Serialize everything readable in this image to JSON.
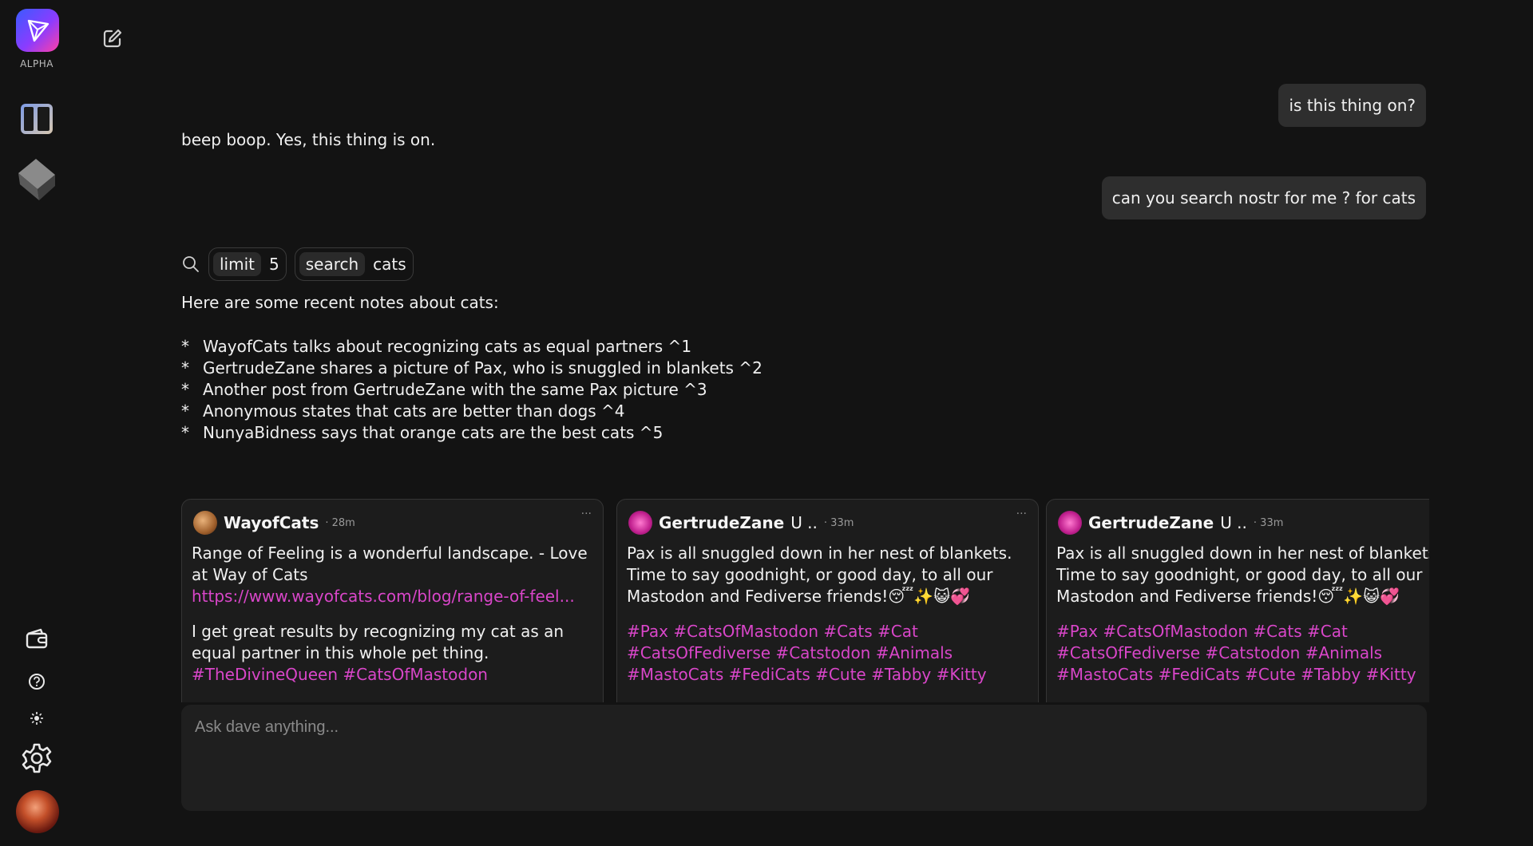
{
  "sidebar": {
    "logo_label": "ALPHA",
    "icons": [
      "app-logo",
      "panel-toggle-icon",
      "cube-icon",
      "wallet-icon",
      "help-icon",
      "theme-icon",
      "gear-icon",
      "avatar"
    ]
  },
  "chat": {
    "user_messages": [
      "is this thing on?",
      "can you search nostr for me ? for cats"
    ],
    "assistant_reply_1": "beep boop. Yes, this thing is on.",
    "tool_call": {
      "limit_key": "limit",
      "limit_value": "5",
      "search_key": "search",
      "search_value": "cats"
    },
    "results_intro": "Here are some recent notes about cats:",
    "results": [
      "WayofCats talks about recognizing cats as equal partners ^1",
      "GertrudeZane shares a picture of Pax, who is snuggled in blankets ^2",
      "Another post from GertrudeZane with the same Pax picture ^3",
      "Anonymous states that cats are better than dogs ^4",
      "NunyaBidness says that orange cats are the best cats ^5"
    ],
    "bullet": "*"
  },
  "notes": [
    {
      "author": "WayofCats",
      "extra": "",
      "time": "· 28m",
      "line1": "Range of Feeling is a wonderful landscape. - Love",
      "line2": "at Way of Cats",
      "link": "https://www.wayofcats.com/blog/range-of-feel...",
      "line3": "I get great results by recognizing my cat as an",
      "line4": "equal partner in this whole pet thing.",
      "tags1": "#TheDivineQueen #CatsOfMastodon"
    },
    {
      "author": "GertrudeZane",
      "extra": "U ..",
      "time": "· 33m",
      "line1": "Pax  is all snuggled down in her nest of blankets.",
      "line2": "Time to say goodnight, or good day, to all our",
      "line3": "Mastodon and Fediverse friends!😴✨😺💞",
      "tags1": "#Pax #CatsOfMastodon #Cats #Cat",
      "tags2": "#CatsOfFediverse #Catstodon #Animals",
      "tags3": "#MastoCats #FediCats #Cute #Tabby #Kitty"
    },
    {
      "author": "GertrudeZane",
      "extra": "U ..",
      "time": "· 33m",
      "line1": "Pax  is all snuggled down in her nest of blankets.",
      "line2": "Time to say goodnight, or good day, to all our",
      "line3": "Mastodon and Fediverse friends!😴✨😺💞",
      "tags1": "#Pax #CatsOfMastodon #Cats #Cat",
      "tags2": "#CatsOfFediverse #Catstodon #Animals",
      "tags3": "#MastoCats #FediCats #Cute #Tabby #Kitty"
    }
  ],
  "card_menu": "···",
  "input": {
    "placeholder": "Ask dave anything..."
  }
}
